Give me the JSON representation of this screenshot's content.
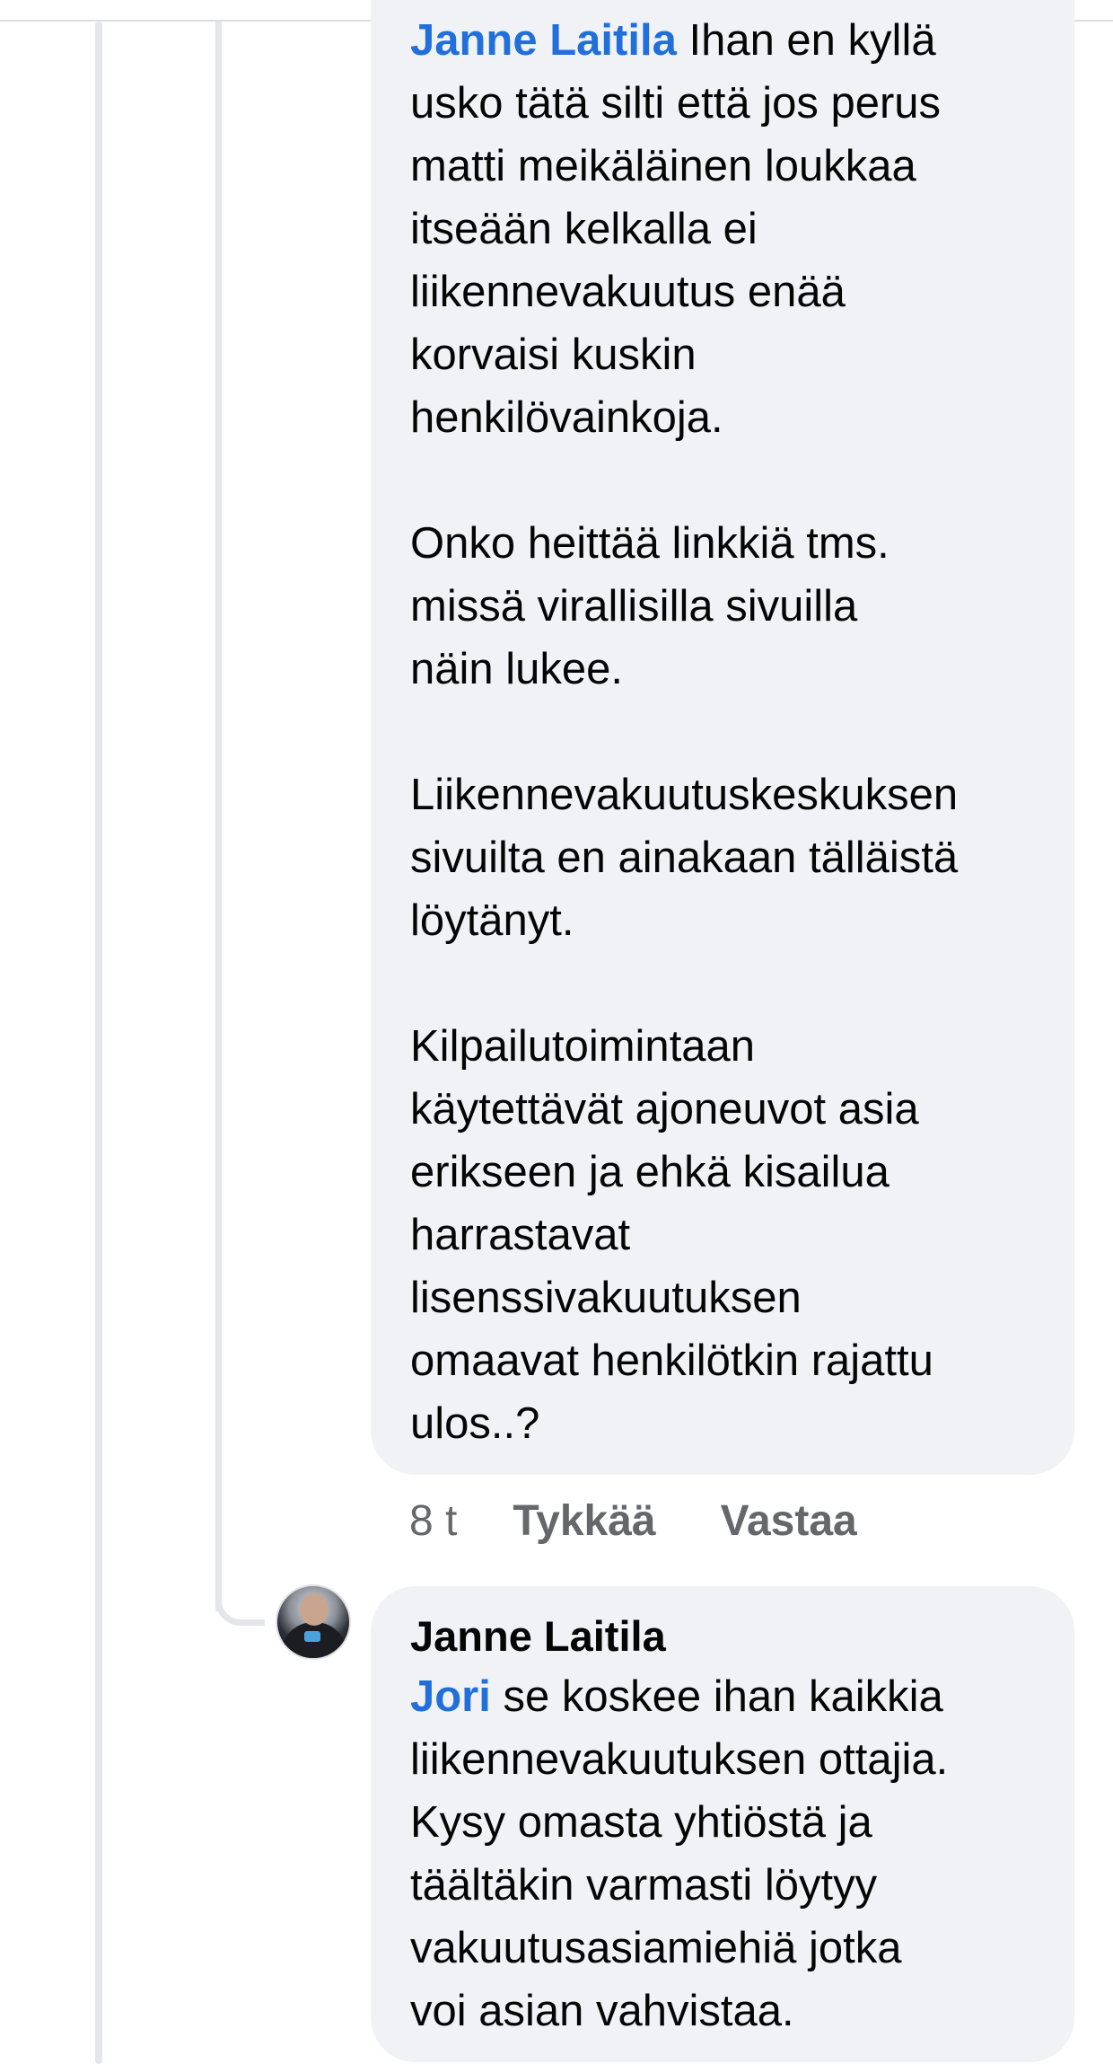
{
  "comment_1": {
    "mention": "Janne Laitila",
    "paragraphs": [
      "Ihan en kyllä\nusko tätä silti että jos perus\nmatti meikäläinen loukkaa\nitseään kelkalla ei\nliikennevakuutus enää\nkorvaisi kuskin\nhenkilövainkoja.",
      "Onko heittää linkkiä tms.\nmissä virallisilla sivuilla\nnäin lukee.",
      "Liikennevakuutuskeskuksen\nsivuilta en ainakaan tälläistä\nlöytänyt.",
      "Kilpailutoimintaan\nkäytettävät ajoneuvot asia\nerikseen ja ehkä kisailua\nharrastavat\nlisenssivakuutuksen\nomaavat henkilötkin rajattu\nulos..?"
    ],
    "actions": {
      "time": "8 t",
      "like_label": "Tykkää",
      "reply_label": "Vastaa"
    }
  },
  "comment_2": {
    "author": "Janne Laitila",
    "mention": "Jori",
    "text": " se koskee ihan kaikkia\nliikennevakuutuksen ottajia.\nKysy omasta yhtiöstä ja\ntäältäkin varmasti löytyy\nvakuutusasiamiehiä jotka\nvoi asian vahvistaa."
  },
  "colors": {
    "mention": "#216fdb",
    "bubble": "#f0f2f5",
    "secondary_text": "#65676b"
  }
}
